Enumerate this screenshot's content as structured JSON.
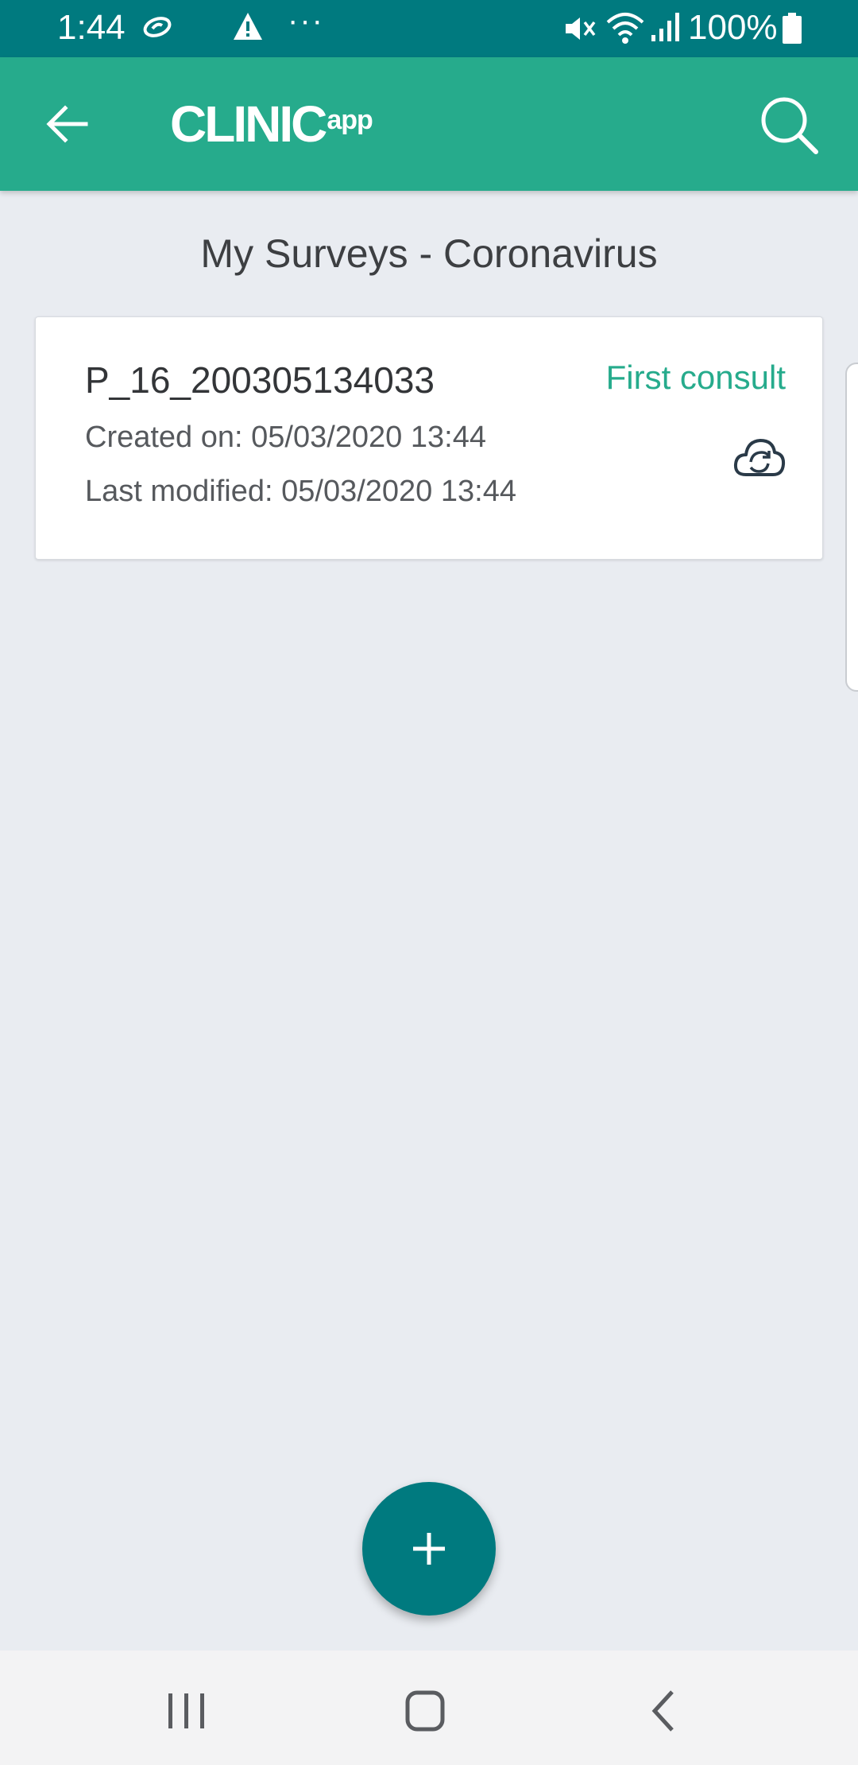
{
  "status_bar": {
    "time": "1:44",
    "more": "···",
    "battery_text": "100%",
    "icons": [
      "app-notification-icon",
      "warning-icon",
      "mute-icon",
      "wifi-icon",
      "signal-icon",
      "battery-icon"
    ]
  },
  "app_bar": {
    "logo_main": "CLINIC",
    "logo_sub": "app",
    "back_icon": "arrow-left-icon",
    "search_icon": "search-icon",
    "color": "#26ab8c"
  },
  "page": {
    "title": "My Surveys - Coronavirus"
  },
  "surveys": [
    {
      "id": "P_16_200305134033",
      "status": "First consult",
      "created": "Created on: 05/03/2020 13:44",
      "modified": "Last modified: 05/03/2020 13:44",
      "icon": "cloud-sync-icon"
    }
  ],
  "fab": {
    "icon": "plus-icon",
    "color": "#007a7f"
  },
  "nav_bar": {
    "icons": [
      "recents-icon",
      "home-icon",
      "back-icon"
    ]
  },
  "colors": {
    "status_bar": "#007a7f",
    "accent": "#26ab8c",
    "background": "#e9ecf1"
  }
}
